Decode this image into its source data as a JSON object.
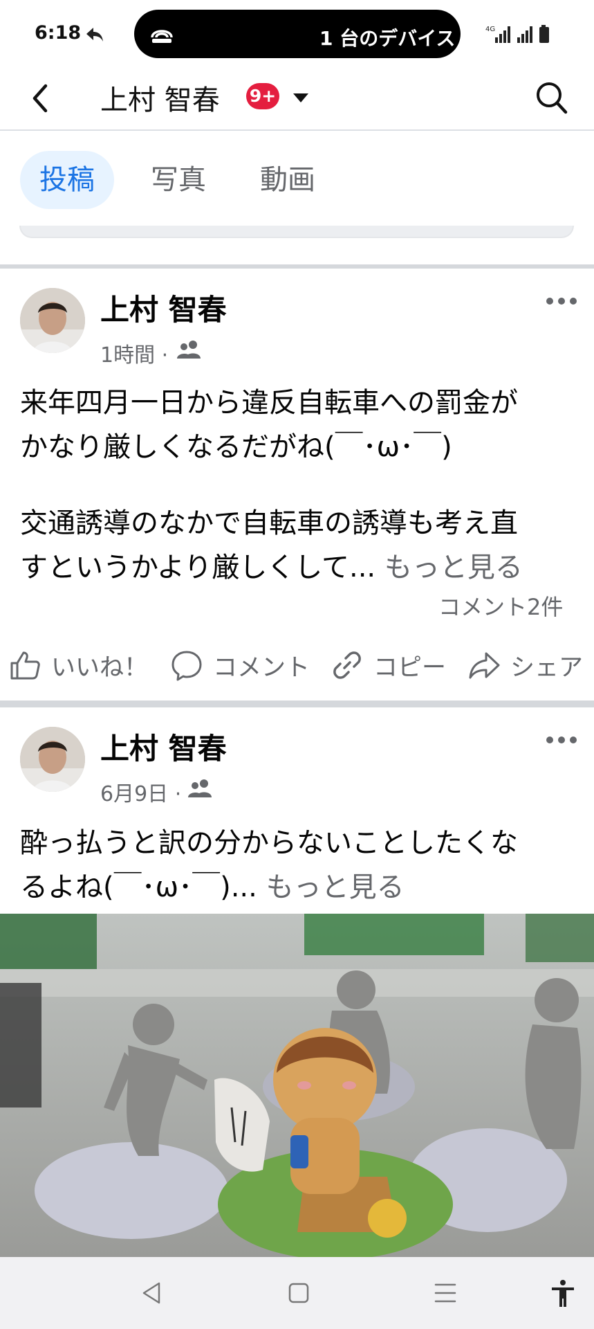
{
  "status_bar": {
    "time": "6:18",
    "device_text": "1 台のデバイス",
    "network": "4G"
  },
  "header": {
    "title": "上村 智春",
    "badge": "9+"
  },
  "tabs": [
    {
      "label": "投稿",
      "active": true
    },
    {
      "label": "写真",
      "active": false
    },
    {
      "label": "動画",
      "active": false
    }
  ],
  "posts": [
    {
      "author": "上村 智春",
      "time": "1時間 ·",
      "text_line1": "来年四月一日から違反自転車への罰金が",
      "text_line2": "かなり厳しくなるだがね(￣･ω･￣)",
      "text_line3": "交通誘導のなかで自転車の誘導も考え直",
      "text_line4": "すというかより厳しくして...",
      "see_more": "もっと見る",
      "comment_count": "コメント2件",
      "actions": {
        "like": "いいね！",
        "comment": "コメント",
        "copy": "コピー",
        "share": "シェア"
      }
    },
    {
      "author": "上村 智春",
      "time": "6月9日 ·",
      "text_line1": "酔っ払うと訳の分からないことしたくな",
      "text_line2": "るよね(￣･ω･￣)...",
      "see_more": "もっと見る"
    }
  ],
  "colors": {
    "accent": "#1b74e4",
    "tab_active_bg": "#e7f3ff",
    "badge": "#e41e3f",
    "secondary_text": "#65676b"
  }
}
